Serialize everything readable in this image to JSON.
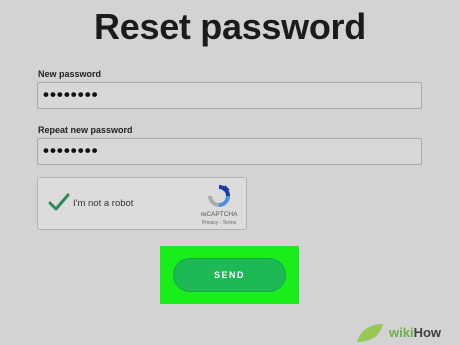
{
  "page": {
    "title": "Reset password"
  },
  "form": {
    "new_password_label": "New password",
    "new_password_value": "••••••••",
    "repeat_password_label": "Repeat new password",
    "repeat_password_value": "••••••••"
  },
  "captcha": {
    "label": "I'm not a robot",
    "brand": "reCAPTCHA",
    "links": "Privacy - Terms",
    "checked": true
  },
  "send_button": {
    "label": "SEND"
  },
  "watermark": {
    "part1": "wiki",
    "part2": "How"
  },
  "colors": {
    "background": "#d3d3d3",
    "accent_green": "#1db954",
    "highlight_green": "#1aee1a",
    "checkmark": "#2e8b57"
  },
  "icons": [
    "checkmark-icon",
    "recaptcha-logo-icon",
    "wikihow-leaf-icon"
  ]
}
